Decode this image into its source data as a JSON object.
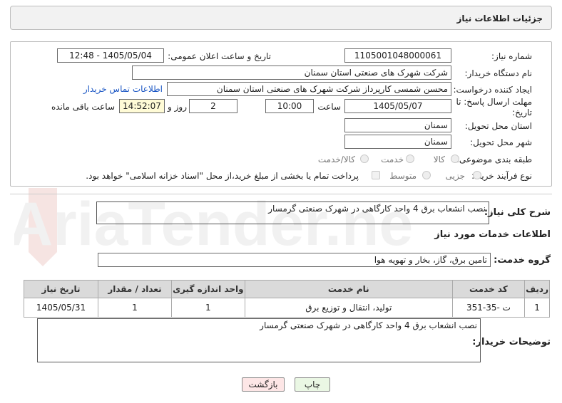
{
  "header": {
    "title": "جزئیات اطلاعات نیاز"
  },
  "form": {
    "need_number_label": "شماره نیاز:",
    "need_number": "1105001048000061",
    "announce_label": "تاریخ و ساعت اعلان عمومی:",
    "announce_value": "1405/05/04 - 12:48",
    "buyer_org_label": "نام دستگاه خریدار:",
    "buyer_org": "شرکت شهرک های صنعتی استان سمنان",
    "requester_label": "ایجاد کننده درخواست:",
    "requester": "محسن شمسی کارپرداز شرکت شهرک های صنعتی استان سمنان",
    "contact_link": "اطلاعات تماس خریدار",
    "deadline_label_1": "مهلت ارسال پاسخ: تا",
    "deadline_label_2": "تاریخ:",
    "deadline_date": "1405/05/07",
    "time_label": "ساعت",
    "deadline_time": "10:00",
    "days_value": "2",
    "days_label": "روز و",
    "remaining_time": "14:52:07",
    "remaining_label": "ساعت باقی مانده",
    "province_label": "استان محل تحویل:",
    "province": "سمنان",
    "city_label": "شهر محل تحویل:",
    "city": "سمنان",
    "category_label": "طبقه بندی موضوعی:",
    "category_options": [
      "کالا",
      "خدمت",
      "کالا/خدمت"
    ],
    "process_label": "نوع فرآیند خرید :",
    "process_options": [
      "جزیی",
      "متوسط"
    ],
    "payment_note": "پرداخت تمام یا بخشی از مبلغ خرید،از محل \"اسناد خزانه اسلامی\" خواهد بود."
  },
  "summary": {
    "label": "شرح کلی نیاز:",
    "text": "نصب انشعاب برق 4 واحد کارگاهی در شهرک صنعتی گرمسار"
  },
  "services": {
    "section_title": "اطلاعات خدمات مورد نیاز",
    "group_label": "گروه خدمت:",
    "group_value": "تامین برق، گاز، بخار و تهویه هوا",
    "columns": [
      "ردیف",
      "کد خدمت",
      "نام خدمت",
      "واحد اندازه گیری",
      "تعداد / مقدار",
      "تاریخ نیاز"
    ],
    "rows": [
      [
        "1",
        "ت -35-351",
        "تولید، انتقال و توزیع برق",
        "1",
        "1",
        "1405/05/31"
      ]
    ]
  },
  "buyer_notes": {
    "label": "توضیحات خریدار:",
    "text": "نصب انشعاب برق 4 واحد کارگاهی در شهرک صنعتی گرمسار"
  },
  "buttons": {
    "print": "چاپ",
    "back": "بازگشت"
  },
  "watermark": {
    "text": "AriaTender.net"
  }
}
